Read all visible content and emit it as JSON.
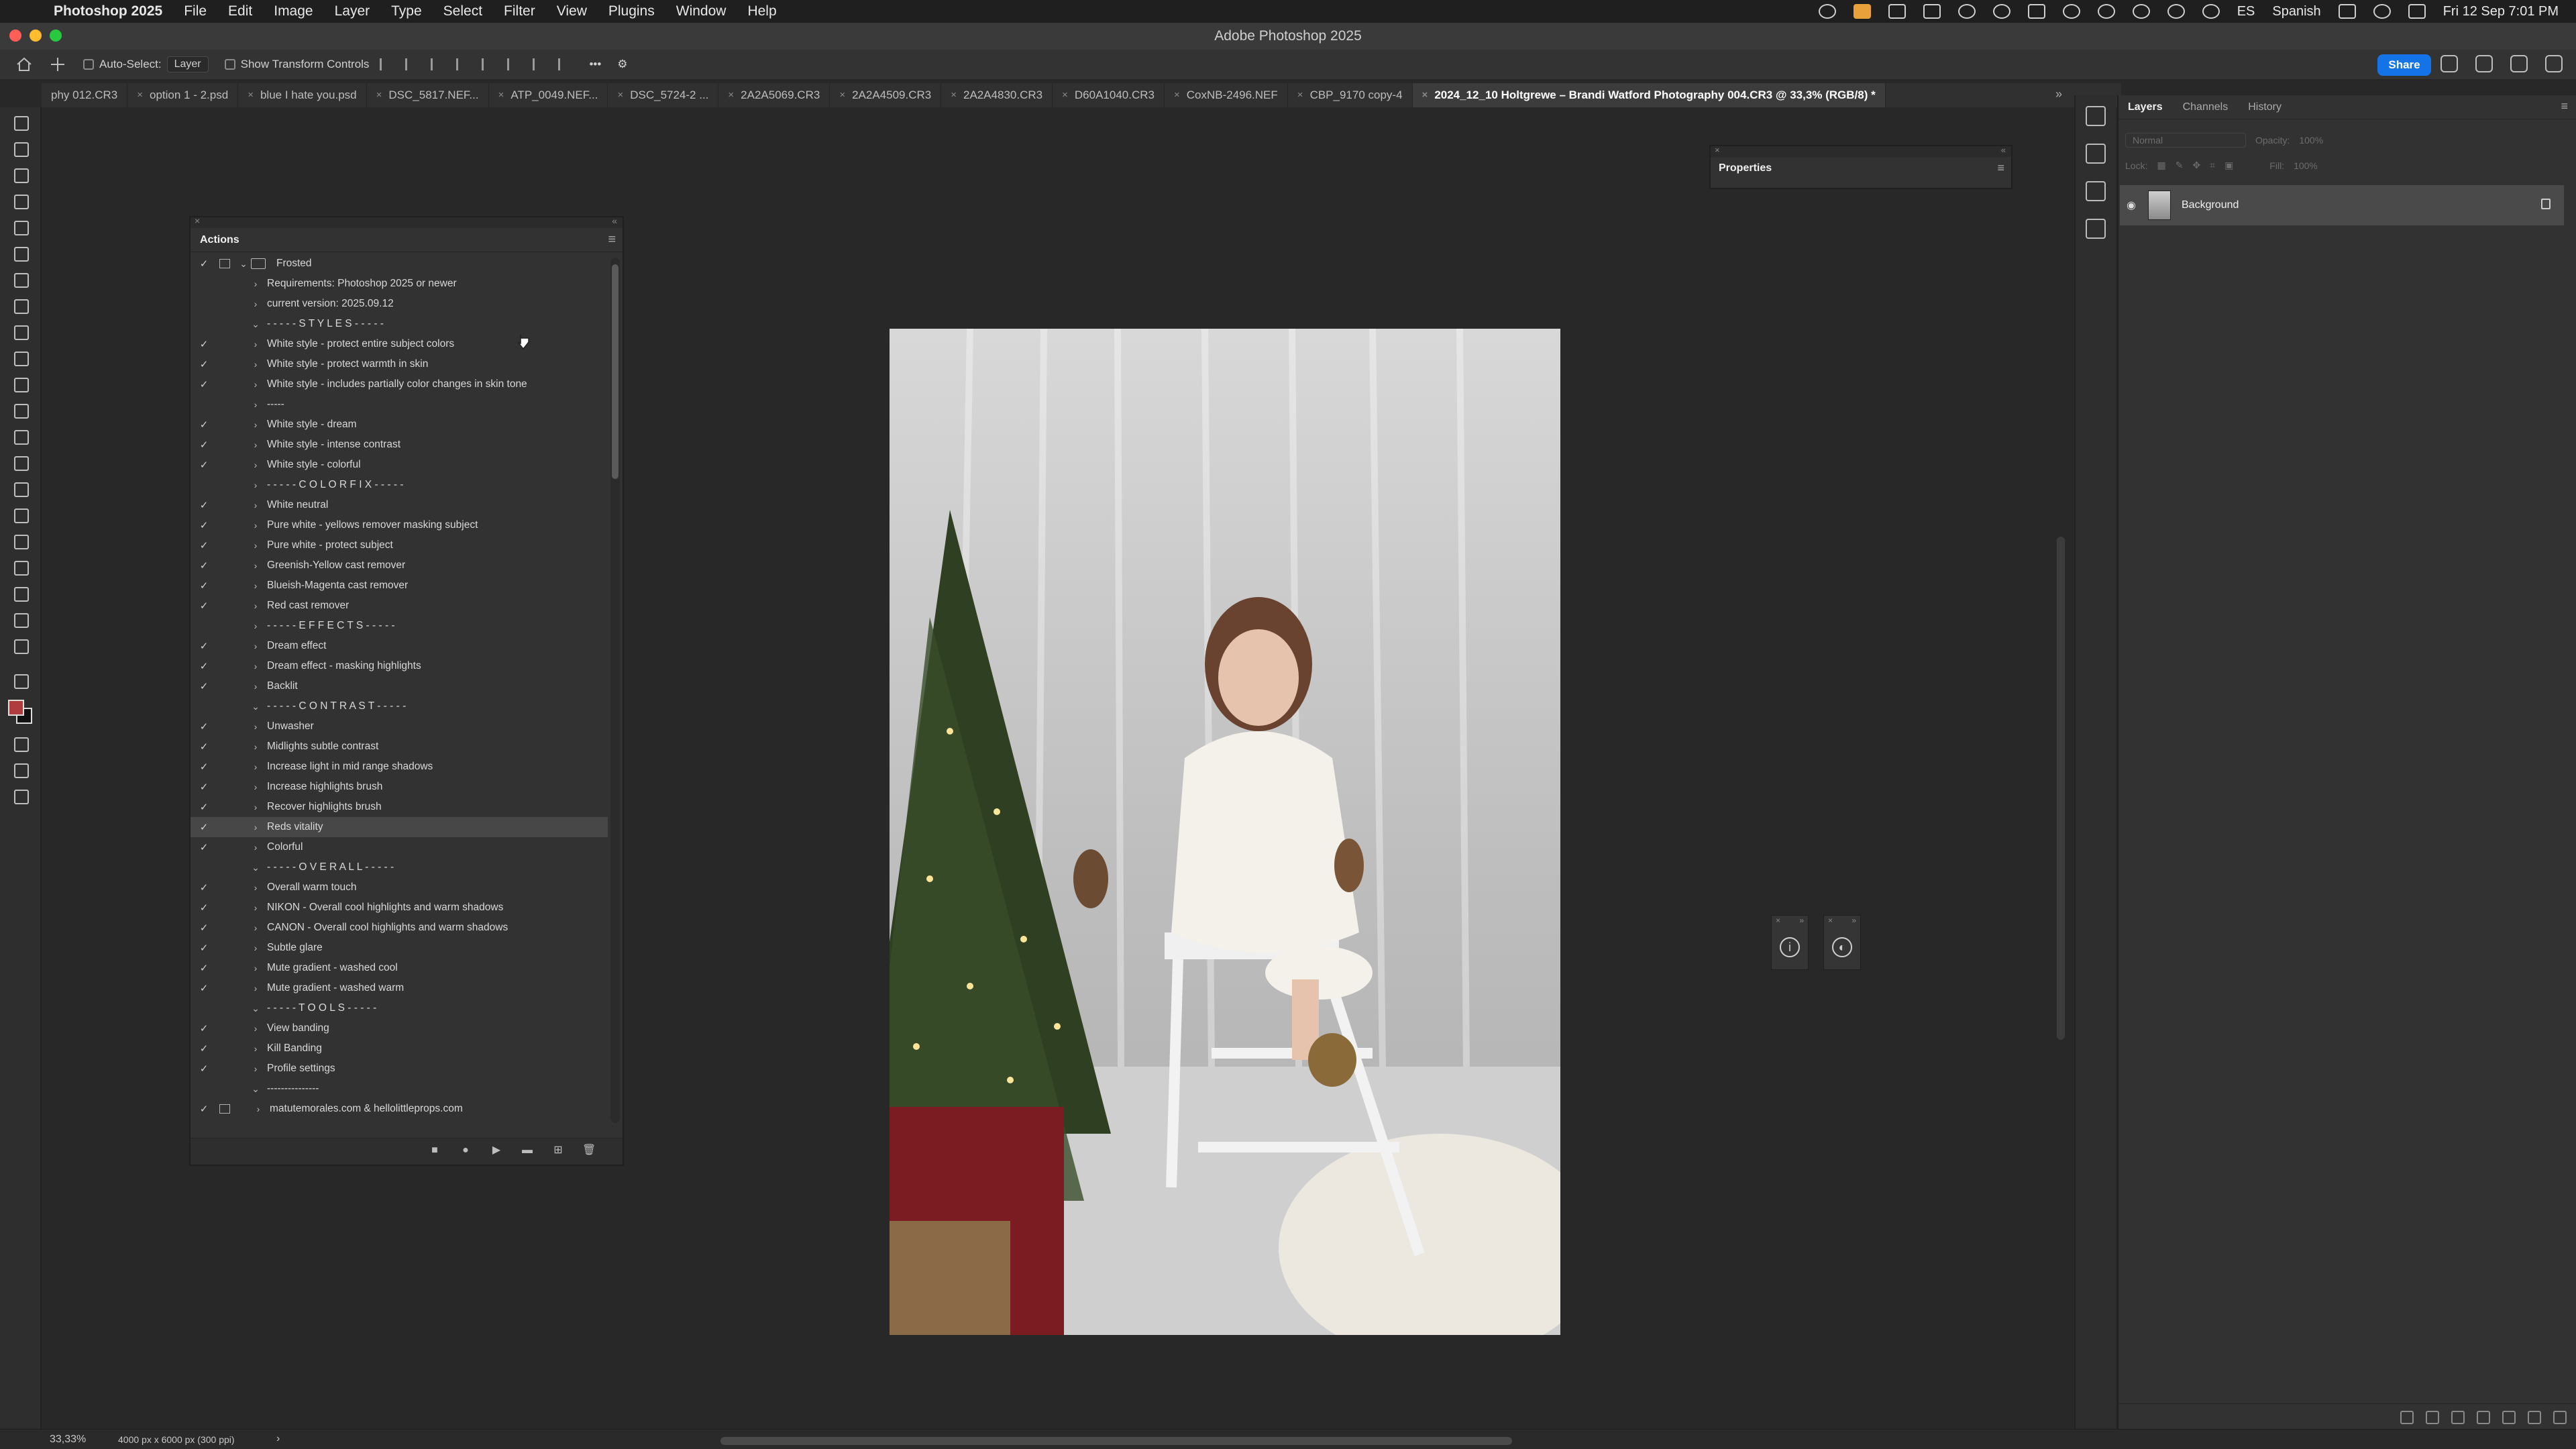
{
  "menubar": {
    "app_name": "Photoshop 2025",
    "items": [
      "File",
      "Edit",
      "Image",
      "Layer",
      "Type",
      "Select",
      "Filter",
      "View",
      "Plugins",
      "Window",
      "Help"
    ],
    "input_source": "ES",
    "language": "Spanish",
    "datetime": "Fri 12 Sep  7:01 PM"
  },
  "window": {
    "title": "Adobe Photoshop 2025"
  },
  "options_bar": {
    "auto_select_label": "Auto-Select:",
    "auto_select_value": "Layer",
    "transform_controls_label": "Show Transform Controls",
    "more_label": "•••",
    "share_label": "Share"
  },
  "tabs": [
    {
      "label": "phy 012.CR3"
    },
    {
      "label": "option 1 - 2.psd"
    },
    {
      "label": "blue I hate you.psd"
    },
    {
      "label": "DSC_5817.NEF..."
    },
    {
      "label": "ATP_0049.NEF..."
    },
    {
      "label": "DSC_5724-2 ..."
    },
    {
      "label": "2A2A5069.CR3"
    },
    {
      "label": "2A2A4509.CR3"
    },
    {
      "label": "2A2A4830.CR3"
    },
    {
      "label": "D60A1040.CR3"
    },
    {
      "label": "CoxNB-2496.NEF"
    },
    {
      "label": "CBP_9170 copy-4"
    },
    {
      "label": "2024_12_10 Holtgrewe – Brandi Watford Photography 004.CR3 @ 33,3% (RGB/8) *"
    }
  ],
  "actions_panel": {
    "tab": "Actions",
    "items": [
      {
        "label": "Frosted",
        "check": "✓",
        "type": "set"
      },
      {
        "label": "Requirements: Photoshop 2025 or newer",
        "check": "",
        "type": "action"
      },
      {
        "label": "current version: 2025.09.12",
        "check": "",
        "type": "action"
      },
      {
        "label": "- - - - - S T Y L E S - - - - -",
        "check": "",
        "type": "divider"
      },
      {
        "label": "White style - protect entire subject colors",
        "check": "✓",
        "type": "action"
      },
      {
        "label": "White style - protect warmth in skin",
        "check": "✓",
        "type": "action"
      },
      {
        "label": "White style - includes partially color changes in skin tone",
        "check": "✓",
        "type": "action"
      },
      {
        "label": "-----",
        "check": "",
        "type": "action"
      },
      {
        "label": "White style - dream",
        "check": "✓",
        "type": "action"
      },
      {
        "label": "White style - intense contrast",
        "check": "✓",
        "type": "action"
      },
      {
        "label": "White style - colorful",
        "check": "✓",
        "type": "action"
      },
      {
        "label": "- - - - - C O L O R   F I X - - - - -",
        "check": "",
        "type": "action"
      },
      {
        "label": "White neutral",
        "check": "✓",
        "type": "action"
      },
      {
        "label": "Pure white - yellows remover masking subject",
        "check": "✓",
        "type": "action"
      },
      {
        "label": "Pure white - protect subject",
        "check": "✓",
        "type": "action"
      },
      {
        "label": "Greenish-Yellow cast remover",
        "check": "✓",
        "type": "action"
      },
      {
        "label": "Blueish-Magenta cast remover",
        "check": "✓",
        "type": "action"
      },
      {
        "label": "Red cast remover",
        "check": "✓",
        "type": "action"
      },
      {
        "label": "- - - - - E F F E C T S - - - - -",
        "check": "",
        "type": "action"
      },
      {
        "label": "Dream effect",
        "check": "✓",
        "type": "action"
      },
      {
        "label": "Dream effect - masking highlights",
        "check": "✓",
        "type": "action"
      },
      {
        "label": "Backlit",
        "check": "✓",
        "type": "action"
      },
      {
        "label": "- - - - - C O N T R A S T - - - - -",
        "check": "",
        "type": "divider"
      },
      {
        "label": "Unwasher",
        "check": "✓",
        "type": "action"
      },
      {
        "label": "Midlights subtle contrast",
        "check": "✓",
        "type": "action"
      },
      {
        "label": "Increase light in mid range shadows",
        "check": "✓",
        "type": "action"
      },
      {
        "label": "Increase highlights brush",
        "check": "✓",
        "type": "action"
      },
      {
        "label": "Recover highlights brush",
        "check": "✓",
        "type": "action"
      },
      {
        "label": "Reds vitality",
        "check": "✓",
        "type": "action",
        "selected": true
      },
      {
        "label": "Colorful",
        "check": "✓",
        "type": "action"
      },
      {
        "label": "- - - - - O V E R A L L - - - - -",
        "check": "",
        "type": "divider"
      },
      {
        "label": "Overall warm touch",
        "check": "✓",
        "type": "action"
      },
      {
        "label": "NIKON - Overall cool highlights and warm shadows",
        "check": "✓",
        "type": "action"
      },
      {
        "label": "CANON - Overall cool highlights and warm shadows",
        "check": "✓",
        "type": "action"
      },
      {
        "label": "Subtle glare",
        "check": "✓",
        "type": "action"
      },
      {
        "label": "Mute gradient - washed cool",
        "check": "✓",
        "type": "action"
      },
      {
        "label": "Mute gradient - washed warm",
        "check": "✓",
        "type": "action"
      },
      {
        "label": "- - - - - T O O L S - - - - -",
        "check": "",
        "type": "divider"
      },
      {
        "label": "View banding",
        "check": "✓",
        "type": "action"
      },
      {
        "label": "Kill Banding",
        "check": "✓",
        "type": "action"
      },
      {
        "label": "Profile settings",
        "check": "✓",
        "type": "action"
      },
      {
        "label": "---------------",
        "check": "",
        "type": "divider"
      },
      {
        "label": "matutemorales.com & hellolittleprops.com",
        "check": "✓",
        "type": "action",
        "dialog": true
      }
    ]
  },
  "properties_panel": {
    "tab": "Properties"
  },
  "layers_panel": {
    "tabs": [
      "Layers",
      "Channels",
      "History"
    ],
    "blend_mode": "Normal",
    "opacity_label": "Opacity:",
    "opacity_value": "100%",
    "lock_label": "Lock:",
    "fill_label": "Fill:",
    "fill_value": "100%",
    "layers": [
      {
        "name": "Background",
        "visible": true,
        "locked": true
      }
    ]
  },
  "status_bar": {
    "zoom": "33,33%",
    "doc_info": "4000 px x 6000 px (300 ppi)"
  },
  "colors": {
    "accent": "#1473e6",
    "foreground_swatch": "#b03c3c",
    "background_swatch": "#111111"
  }
}
